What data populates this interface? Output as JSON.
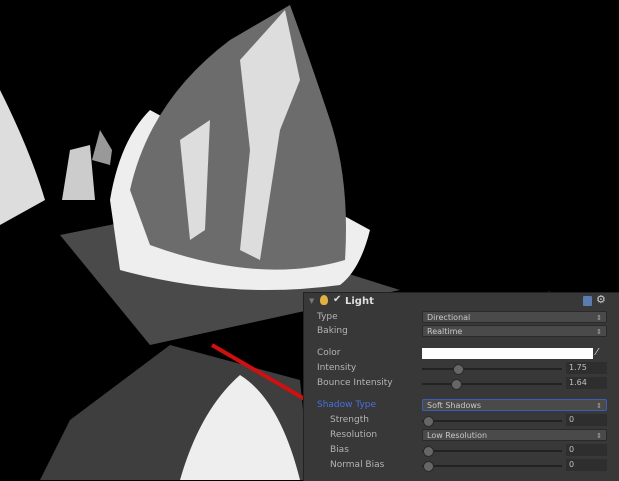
{
  "scene": {
    "pointer_color": "#d01010"
  },
  "component": {
    "title": "Light",
    "enabled": true,
    "type": {
      "label": "Type",
      "value": "Directional"
    },
    "baking": {
      "label": "Baking",
      "value": "Realtime"
    },
    "color": {
      "label": "Color",
      "value": "#ffffff"
    },
    "intensity": {
      "label": "Intensity",
      "value": "1.75",
      "fraction": 0.22
    },
    "bounce_intensity": {
      "label": "Bounce Intensity",
      "value": "1.64",
      "fraction": 0.2
    },
    "shadow_type": {
      "label": "Shadow Type",
      "value": "Soft Shadows"
    },
    "strength": {
      "label": "Strength",
      "value": "0",
      "fraction": 0
    },
    "resolution": {
      "label": "Resolution",
      "value": "Low Resolution"
    },
    "bias": {
      "label": "Bias",
      "value": "0",
      "fraction": 0
    },
    "normal_bias": {
      "label": "Normal Bias",
      "value": "0",
      "fraction": 0
    }
  }
}
